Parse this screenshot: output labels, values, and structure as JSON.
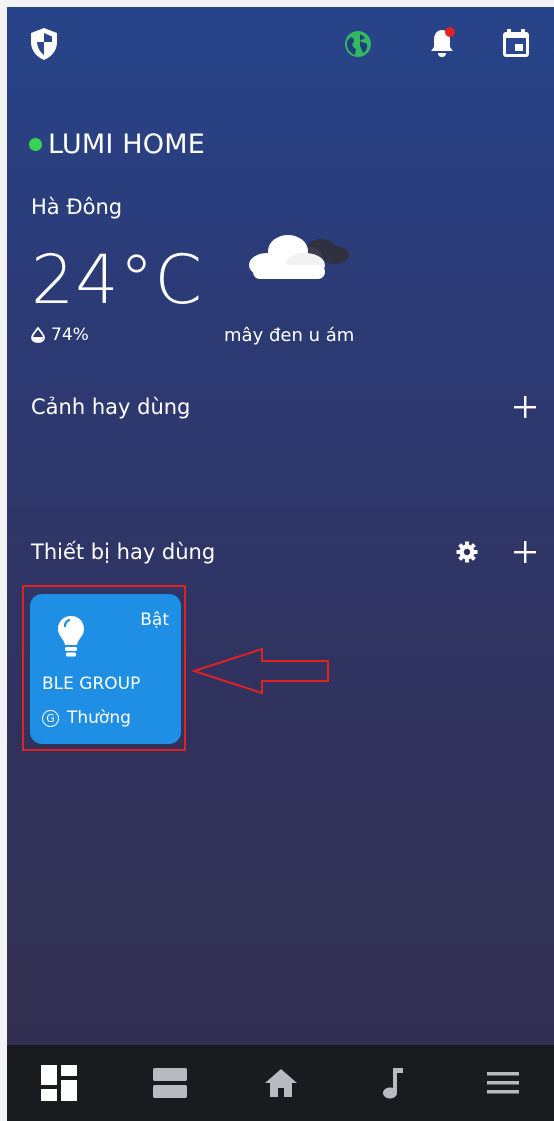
{
  "home": {
    "name": "LUMI HOME",
    "status_color": "#39d353"
  },
  "weather": {
    "location": "Hà Đông",
    "temperature": "24°C",
    "humidity": "74%",
    "description": "mây đen u ám",
    "icon": "cloudy-icon"
  },
  "sections": {
    "scenes_title": "Cảnh hay dùng",
    "devices_title": "Thiết bị hay dùng"
  },
  "device_card": {
    "state": "Bật",
    "name": "BLE GROUP",
    "mode": "Thường",
    "icon": "lightbulb-icon",
    "color": "#1e8fe5"
  },
  "top_bar": {
    "icons": [
      "shield-icon",
      "globe-icon",
      "bell-icon",
      "calendar-icon"
    ]
  },
  "bottom_nav": {
    "items": [
      "dashboard-icon",
      "rooms-icon",
      "home-icon",
      "music-icon",
      "menu-icon"
    ]
  }
}
